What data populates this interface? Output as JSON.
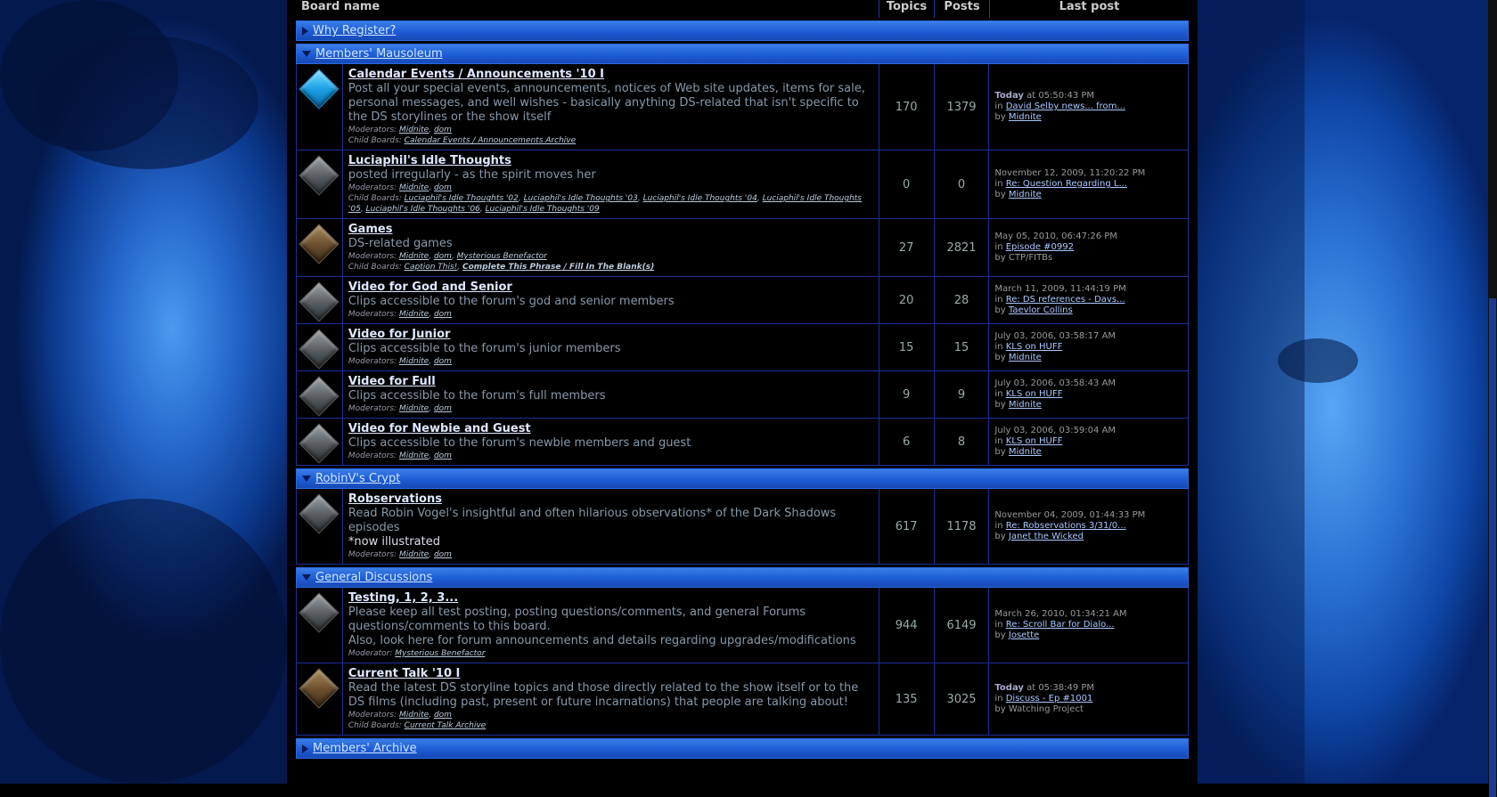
{
  "header": {
    "board_name": "Board name",
    "topics": "Topics",
    "posts": "Posts",
    "last_post": "Last post"
  },
  "categories": [
    {
      "name": "Why Register?",
      "collapsed": true,
      "boards": []
    },
    {
      "name": "Members' Mausoleum",
      "collapsed": false,
      "boards": [
        {
          "icon": "blue",
          "title": "Calendar Events / Announcements '10 I",
          "desc": [
            "Post all your special events, announcements, notices of Web site updates, items for sale, personal messages, and well wishes - basically anything DS-related that isn't specific to the DS storylines or the show itself"
          ],
          "mods_label": "Moderators:",
          "mods": [
            "Midnite",
            "dom"
          ],
          "child_label": "Child Boards:",
          "children": [
            "Calendar Events / Announcements Archive"
          ],
          "topics": "170",
          "posts": "1379",
          "last": {
            "date_bold": "Today",
            "date": " at 05:50:43 PM",
            "in": "David Selby news... from...",
            "by": "Midnite",
            "by_link": true
          }
        },
        {
          "icon": "gray",
          "title": "Luciaphil's Idle Thoughts",
          "desc": [
            "posted irregularly - as the spirit moves her"
          ],
          "mods_label": "Moderators:",
          "mods": [
            "Midnite",
            "dom"
          ],
          "child_label": "Child Boards:",
          "children": [
            "Luciaphil's Idle Thoughts '02",
            "Luciaphil's Idle Thoughts '03",
            "Luciaphil's Idle Thoughts '04",
            "Luciaphil's Idle Thoughts '05",
            "Luciaphil's Idle Thoughts '06",
            "Luciaphil's Idle Thoughts '09"
          ],
          "topics": "0",
          "posts": "0",
          "last": {
            "date_bold": "",
            "date": "November 12, 2009, 11:20:22 PM",
            "in": "Re: Question Regarding L...",
            "by": "Midnite",
            "by_link": true
          }
        },
        {
          "icon": "brown",
          "title": "Games",
          "desc": [
            "DS-related games"
          ],
          "mods_label": "Moderators:",
          "mods": [
            "Midnite",
            "dom",
            "Mysterious Benefactor"
          ],
          "child_label": "Child Boards:",
          "children": [
            "Caption This!",
            "Complete This Phrase / Fill In The Blank(s)"
          ],
          "bold_children": [
            false,
            true
          ],
          "topics": "27",
          "posts": "2821",
          "last": {
            "date_bold": "",
            "date": "May 05, 2010, 06:47:26 PM",
            "in": "Episode #0992",
            "by": "CTP/FITBs",
            "by_link": false
          }
        },
        {
          "icon": "gray",
          "title": "Video for God and Senior",
          "desc": [
            "Clips accessible to the forum's god and senior members"
          ],
          "mods_label": "Moderators:",
          "mods": [
            "Midnite",
            "dom"
          ],
          "topics": "20",
          "posts": "28",
          "last": {
            "date_bold": "",
            "date": "March 11, 2009, 11:44:19 PM",
            "in": "Re: DS references - Davs...",
            "by": "Taevlor Collins",
            "by_link": true
          }
        },
        {
          "icon": "gray",
          "title": "Video for Junior",
          "desc": [
            "Clips accessible to the forum's junior members"
          ],
          "mods_label": "Moderators:",
          "mods": [
            "Midnite",
            "dom"
          ],
          "topics": "15",
          "posts": "15",
          "last": {
            "date_bold": "",
            "date": "July 03, 2006, 03:58:17 AM",
            "in": "KLS on HUFF",
            "by": "Midnite",
            "by_link": true
          }
        },
        {
          "icon": "gray",
          "title": "Video for Full",
          "desc": [
            "Clips accessible to the forum's full members"
          ],
          "mods_label": "Moderators:",
          "mods": [
            "Midnite",
            "dom"
          ],
          "topics": "9",
          "posts": "9",
          "last": {
            "date_bold": "",
            "date": "July 03, 2006, 03:58:43 AM",
            "in": "KLS on HUFF",
            "by": "Midnite",
            "by_link": true
          }
        },
        {
          "icon": "gray",
          "title": "Video for Newbie and Guest",
          "desc": [
            "Clips accessible to the forum's newbie members and guest"
          ],
          "mods_label": "Moderators:",
          "mods": [
            "Midnite",
            "dom"
          ],
          "topics": "6",
          "posts": "8",
          "last": {
            "date_bold": "",
            "date": "July 03, 2006, 03:59:04 AM",
            "in": "KLS on HUFF",
            "by": "Midnite",
            "by_link": true
          }
        }
      ]
    },
    {
      "name": "RobinV's Crypt",
      "collapsed": false,
      "boards": [
        {
          "icon": "gray",
          "title": "Robservations",
          "desc": [
            "Read Robin Vogel's insightful and often hilarious observations* of the Dark Shadows episodes"
          ],
          "desc_white": "*now illustrated",
          "mods_label": "Moderators:",
          "mods": [
            "Midnite",
            "dom"
          ],
          "topics": "617",
          "posts": "1178",
          "last": {
            "date_bold": "",
            "date": "November 04, 2009, 01:44:33 PM",
            "in": "Re: Robservations 3/31/0...",
            "by": "Janet the Wicked",
            "by_link": true
          }
        }
      ]
    },
    {
      "name": "General Discussions",
      "collapsed": false,
      "boards": [
        {
          "icon": "gray",
          "title": "Testing, 1, 2, 3...",
          "desc": [
            "Please keep all test posting, posting questions/comments, and general Forums questions/comments to this board.",
            "Also, look here for forum announcements and details regarding upgrades/modifications"
          ],
          "mods_label": "Moderator:",
          "mods": [
            "Mysterious Benefactor"
          ],
          "topics": "944",
          "posts": "6149",
          "last": {
            "date_bold": "",
            "date": "March 26, 2010, 01:34:21 AM",
            "in": "Re: Scroll Bar for Dialo...",
            "by": "Josette",
            "by_link": true
          }
        },
        {
          "icon": "brown",
          "title": "Current Talk '10 I",
          "desc": [
            "Read the latest DS storyline topics and those directly related to the show itself or to the DS films (including past, present or future incarnations) that people are talking about!"
          ],
          "mods_label": "Moderators:",
          "mods": [
            "Midnite",
            "dom"
          ],
          "child_label": "Child Boards:",
          "children": [
            "Current Talk Archive"
          ],
          "topics": "135",
          "posts": "3025",
          "last": {
            "date_bold": "Today",
            "date": " at 05:38:49 PM",
            "in": "Discuss - Ep #1001",
            "by": "Watching Project",
            "by_link": false
          }
        }
      ]
    },
    {
      "name": "Members' Archive",
      "collapsed": true,
      "boards": []
    }
  ],
  "labels": {
    "in": "in ",
    "by": "by "
  }
}
